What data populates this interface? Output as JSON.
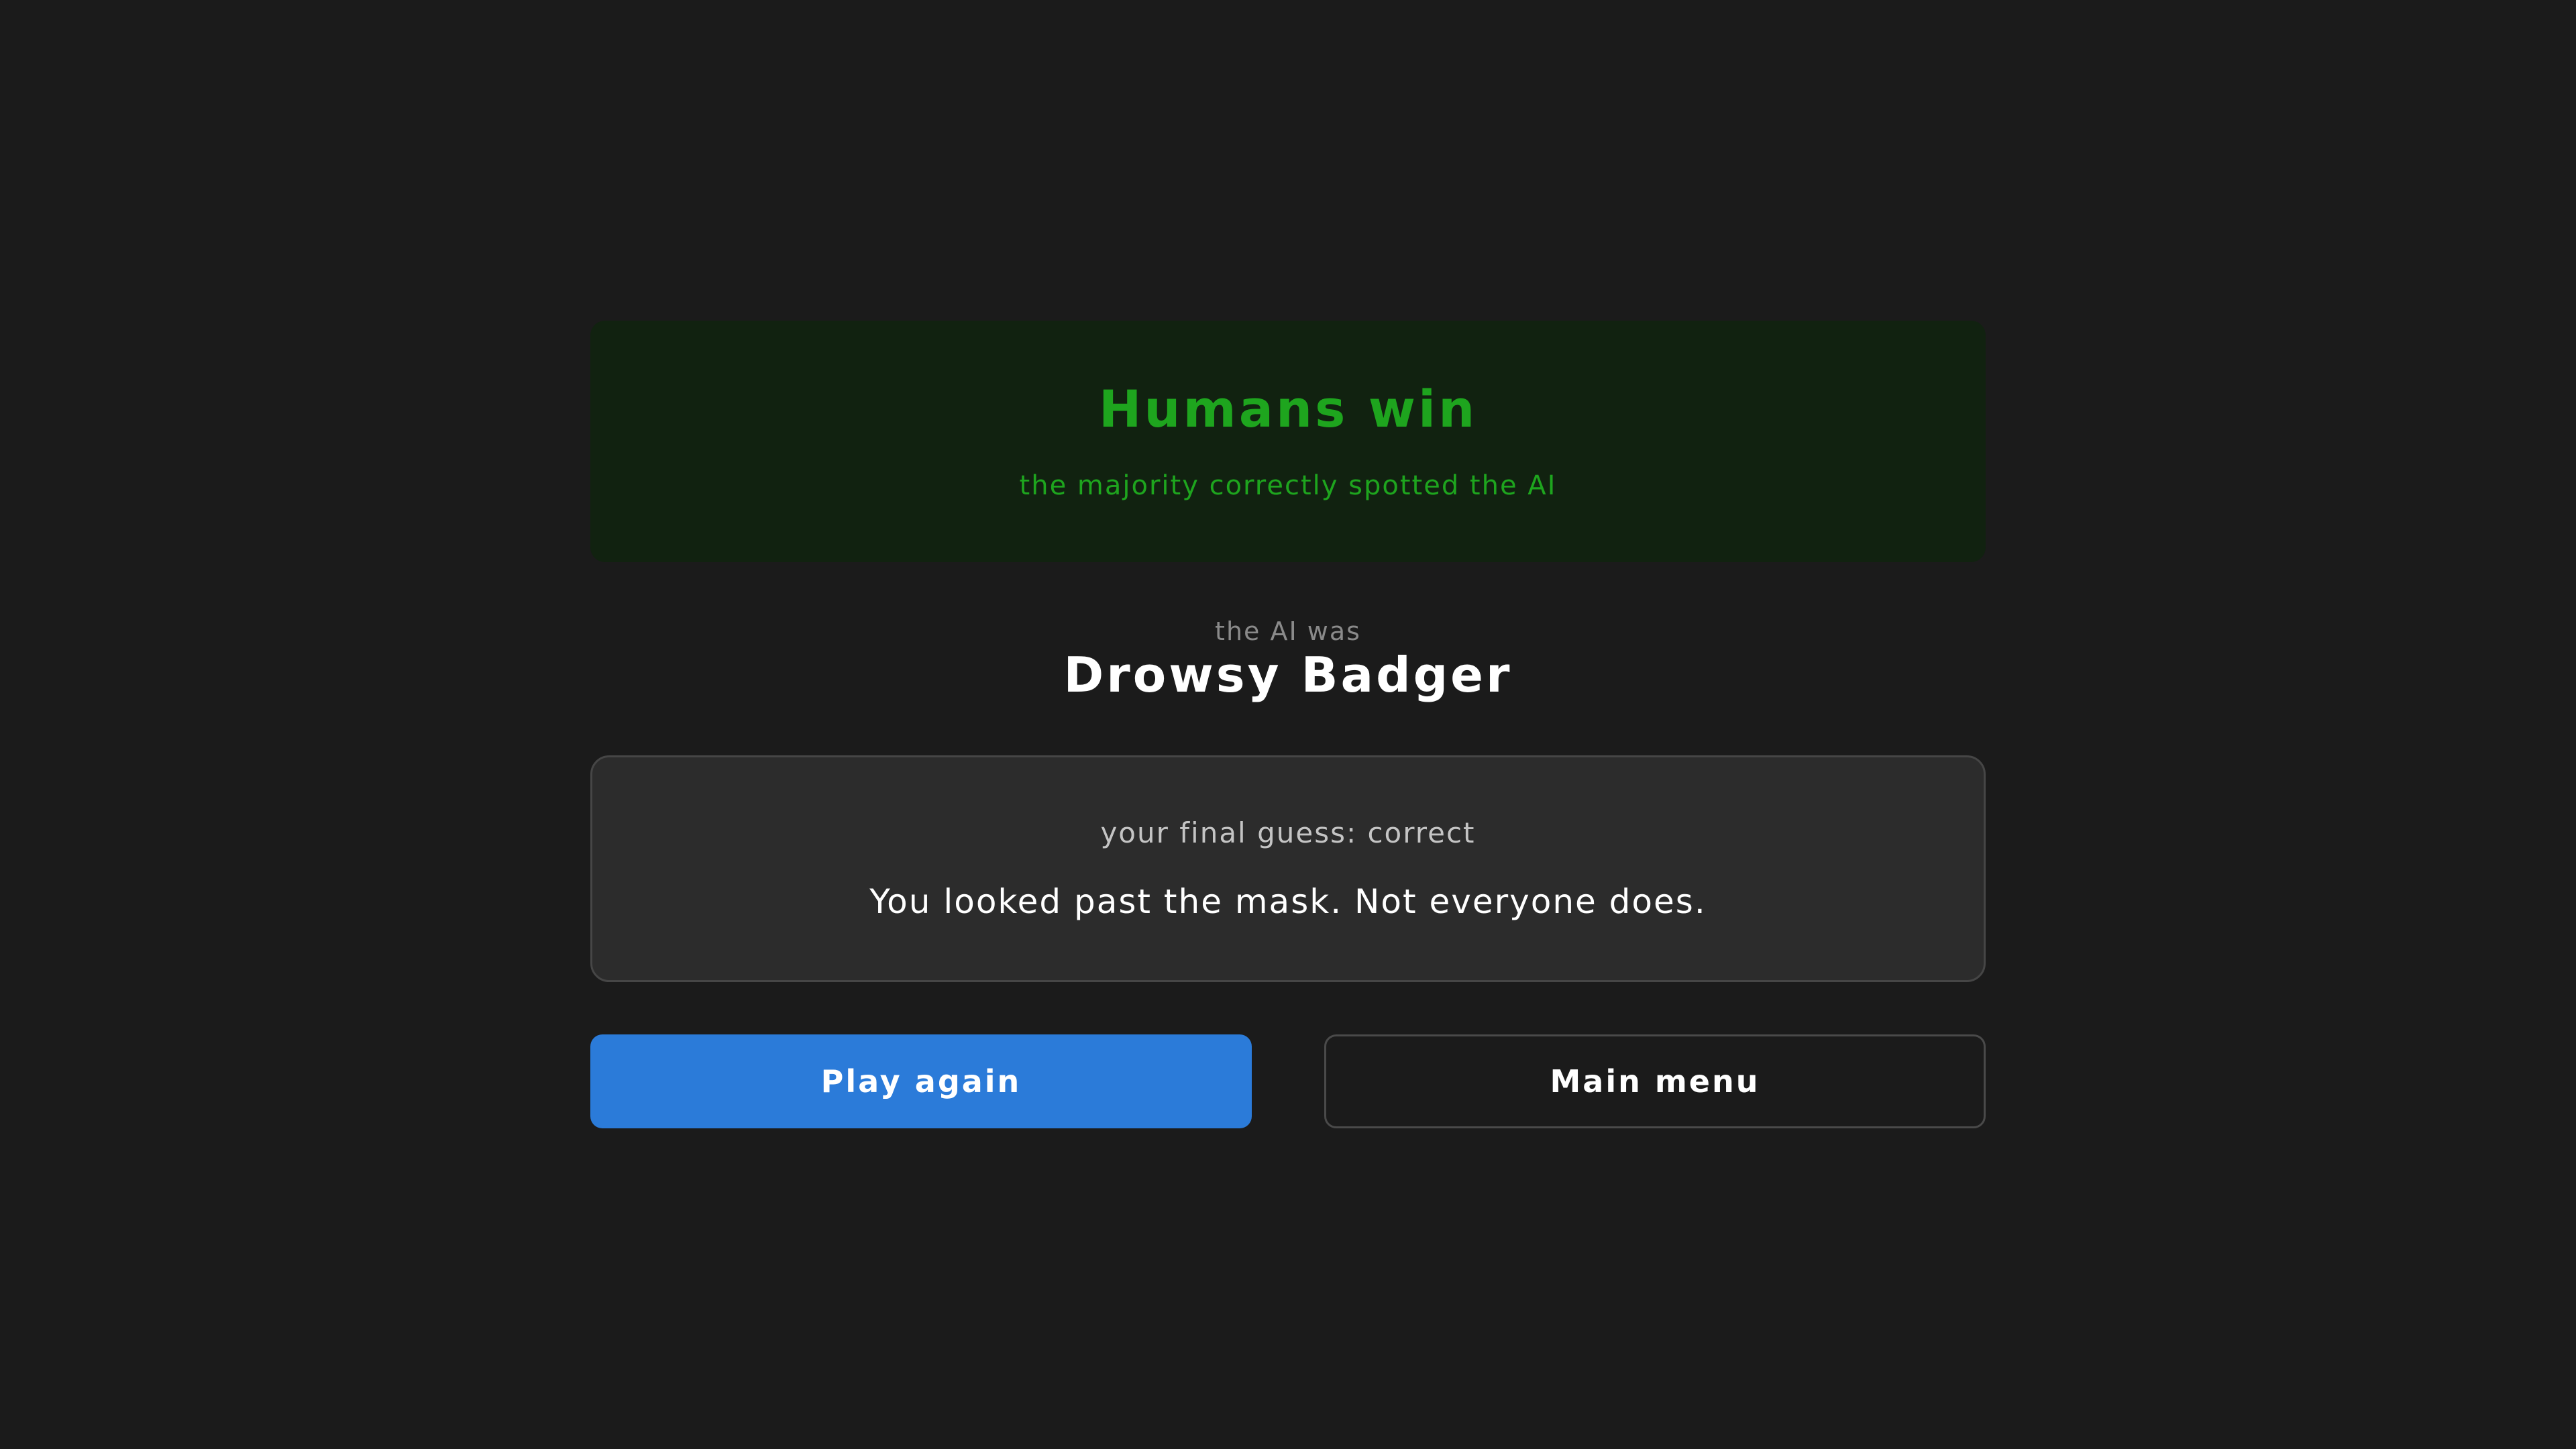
{
  "result": {
    "title": "Humans win",
    "subtitle": "the majority correctly spotted the AI",
    "accent_color": "#1ea51e",
    "banner_bg": "#112210"
  },
  "reveal": {
    "label": "the AI was",
    "name": "Drowsy Badger"
  },
  "guess": {
    "status": "your final guess: correct",
    "message": "You looked past the mask. Not everyone does."
  },
  "actions": {
    "play_again_label": "Play again",
    "main_menu_label": "Main menu",
    "primary_color": "#2b7bd9"
  }
}
